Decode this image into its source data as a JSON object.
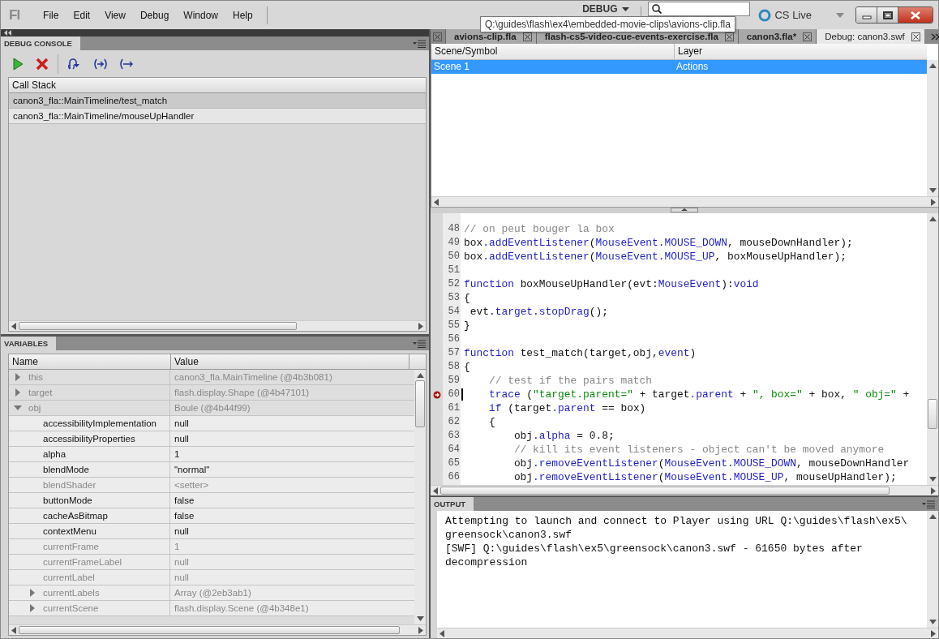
{
  "menu_bar": {
    "logo": "Fl",
    "items": [
      "File",
      "Edit",
      "View",
      "Debug",
      "Window",
      "Help"
    ]
  },
  "workspace": {
    "label": "DEBUG"
  },
  "cs_live": {
    "label": "CS Live"
  },
  "tooltip": {
    "text": "Q:\\guides\\flash\\ex4\\embedded-movie-clips\\avions-clip.fla"
  },
  "debug_console": {
    "title": "DEBUG CONSOLE",
    "call_stack": {
      "heading": "Call Stack",
      "frames": [
        {
          "label": "canon3_fla::MainTimeline/test_match",
          "selected": true
        },
        {
          "label": "canon3_fla::MainTimeline/mouseUpHandler",
          "selected": false
        }
      ]
    }
  },
  "variables": {
    "title": "VARIABLES",
    "columns": [
      "Name",
      "Value"
    ],
    "rows": [
      {
        "kind": "object",
        "name": "this",
        "value": "canon3_fla.MainTimeline (@4b3b081)",
        "expanded": false,
        "dimmed": true
      },
      {
        "kind": "object",
        "name": "target",
        "value": "flash.display.Shape (@4b47101)",
        "expanded": false,
        "dimmed": true
      },
      {
        "kind": "object",
        "name": "obj",
        "value": "Boule (@4b44f99)",
        "expanded": true,
        "dimmed": true,
        "children": [
          {
            "kind": "property",
            "name": "accessibilityImplementation",
            "value": "null",
            "dimmed": false
          },
          {
            "kind": "property",
            "name": "accessibilityProperties",
            "value": "null",
            "dimmed": false
          },
          {
            "kind": "property",
            "name": "alpha",
            "value": "1",
            "dimmed": false
          },
          {
            "kind": "property",
            "name": "blendMode",
            "value": "\"normal\"",
            "dimmed": false
          },
          {
            "kind": "property",
            "name": "blendShader",
            "value": "<setter>",
            "dimmed": true
          },
          {
            "kind": "property",
            "name": "buttonMode",
            "value": "false",
            "dimmed": false
          },
          {
            "kind": "property",
            "name": "cacheAsBitmap",
            "value": "false",
            "dimmed": false
          },
          {
            "kind": "property",
            "name": "contextMenu",
            "value": "null",
            "dimmed": false
          },
          {
            "kind": "property",
            "name": "currentFrame",
            "value": "1",
            "dimmed": true
          },
          {
            "kind": "property",
            "name": "currentFrameLabel",
            "value": "null",
            "dimmed": true
          },
          {
            "kind": "property",
            "name": "currentLabel",
            "value": "null",
            "dimmed": true
          },
          {
            "kind": "object",
            "name": "currentLabels",
            "value": "Array (@2eb3ab1)",
            "expanded": false,
            "dimmed": true
          },
          {
            "kind": "object",
            "name": "currentScene",
            "value": "flash.display.Scene (@4b348e1)",
            "expanded": false,
            "dimmed": true
          }
        ]
      }
    ]
  },
  "document_tabs": [
    {
      "label": "avions-clip.fla",
      "selected": false
    },
    {
      "label": "flash-cs5-video-cue-events-exercise.fla",
      "selected": false
    },
    {
      "label": "canon3.fla*",
      "selected": false
    },
    {
      "label": "Debug: canon3.swf",
      "selected": true
    }
  ],
  "scene_table": {
    "columns": [
      "Scene/Symbol",
      "Layer"
    ],
    "rows": [
      {
        "cells": [
          "Scene 1",
          "Actions"
        ],
        "selected": true
      }
    ]
  },
  "code": {
    "lines": [
      {
        "number": "48",
        "current": false,
        "segments": [
          {
            "kind": "comment",
            "text": "// on peut bouger la box"
          }
        ]
      },
      {
        "number": "49",
        "current": false,
        "segments": [
          {
            "kind": "plain",
            "text": "box"
          },
          {
            "kind": "keyword",
            "text": ".addEventListener"
          },
          {
            "kind": "plain",
            "text": "("
          },
          {
            "kind": "keyword",
            "text": "MouseEvent.MOUSE_DOWN"
          },
          {
            "kind": "plain",
            "text": ", mouseDownHandler);"
          }
        ]
      },
      {
        "number": "50",
        "current": false,
        "segments": [
          {
            "kind": "plain",
            "text": "box"
          },
          {
            "kind": "keyword",
            "text": ".addEventListener"
          },
          {
            "kind": "plain",
            "text": "("
          },
          {
            "kind": "keyword",
            "text": "MouseEvent.MOUSE_UP"
          },
          {
            "kind": "plain",
            "text": ", boxMouseUpHandler);"
          }
        ]
      },
      {
        "number": "51",
        "current": false
      },
      {
        "number": "52",
        "current": false,
        "segments": [
          {
            "kind": "keyword",
            "text": "function"
          },
          {
            "kind": "plain",
            "text": " boxMouseUpHandler(evt:"
          },
          {
            "kind": "keyword",
            "text": "MouseEvent"
          },
          {
            "kind": "plain",
            "text": "):"
          },
          {
            "kind": "keyword",
            "text": "void"
          }
        ]
      },
      {
        "number": "53",
        "current": false,
        "segments": [
          {
            "kind": "plain",
            "text": "{"
          }
        ]
      },
      {
        "number": "54",
        "current": false,
        "segments": [
          {
            "kind": "plain",
            "text": " evt"
          },
          {
            "kind": "keyword",
            "text": ".target.stopDrag"
          },
          {
            "kind": "plain",
            "text": "();"
          }
        ]
      },
      {
        "number": "55",
        "current": false,
        "segments": [
          {
            "kind": "plain",
            "text": "}"
          }
        ]
      },
      {
        "number": "56",
        "current": false
      },
      {
        "number": "57",
        "current": false,
        "segments": [
          {
            "kind": "keyword",
            "text": "function"
          },
          {
            "kind": "plain",
            "text": " test_match(target,obj,"
          },
          {
            "kind": "keyword",
            "text": "event"
          },
          {
            "kind": "plain",
            "text": ")"
          }
        ]
      },
      {
        "number": "58",
        "current": false,
        "segments": [
          {
            "kind": "plain",
            "text": "{"
          }
        ]
      },
      {
        "number": "59",
        "current": false,
        "segments": [
          {
            "kind": "comment",
            "text": "    // test if the pairs match"
          }
        ]
      },
      {
        "number": "60",
        "current": true,
        "segments": [
          {
            "kind": "keyword",
            "text": "    trace"
          },
          {
            "kind": "plain",
            "text": " ("
          },
          {
            "kind": "string",
            "text": "\"target.parent=\""
          },
          {
            "kind": "plain",
            "text": " + target"
          },
          {
            "kind": "keyword",
            "text": ".parent"
          },
          {
            "kind": "plain",
            "text": " + "
          },
          {
            "kind": "string",
            "text": "\", box=\""
          },
          {
            "kind": "plain",
            "text": " + box, "
          },
          {
            "kind": "string",
            "text": "\" obj=\""
          },
          {
            "kind": "plain",
            "text": " +"
          }
        ]
      },
      {
        "number": "61",
        "current": false,
        "segments": [
          {
            "kind": "keyword",
            "text": "    if"
          },
          {
            "kind": "plain",
            "text": " (target"
          },
          {
            "kind": "keyword",
            "text": ".parent"
          },
          {
            "kind": "plain",
            "text": " == box)"
          }
        ]
      },
      {
        "number": "62",
        "current": false,
        "segments": [
          {
            "kind": "plain",
            "text": "    {"
          }
        ]
      },
      {
        "number": "63",
        "current": false,
        "segments": [
          {
            "kind": "plain",
            "text": "        obj"
          },
          {
            "kind": "keyword",
            "text": ".alpha"
          },
          {
            "kind": "plain",
            "text": " = 0.8;"
          }
        ]
      },
      {
        "number": "64",
        "current": false,
        "segments": [
          {
            "kind": "comment",
            "text": "        // kill its event listeners - object can't be moved anymore"
          }
        ]
      },
      {
        "number": "65",
        "current": false,
        "segments": [
          {
            "kind": "plain",
            "text": "        obj"
          },
          {
            "kind": "keyword",
            "text": ".removeEventListener"
          },
          {
            "kind": "plain",
            "text": "("
          },
          {
            "kind": "keyword",
            "text": "MouseEvent.MOUSE_DOWN"
          },
          {
            "kind": "plain",
            "text": ", mouseDownHandler"
          }
        ]
      },
      {
        "number": "66",
        "current": false,
        "segments": [
          {
            "kind": "plain",
            "text": "        obj"
          },
          {
            "kind": "keyword",
            "text": ".removeEventListener"
          },
          {
            "kind": "plain",
            "text": "("
          },
          {
            "kind": "keyword",
            "text": "MouseEvent.MOUSE_UP"
          },
          {
            "kind": "plain",
            "text": ", mouseUpHandler);"
          }
        ]
      }
    ]
  },
  "output": {
    "title": "OUTPUT",
    "lines": [
      "Attempting to launch and connect to Player using URL Q:\\guides\\flash\\ex5\\",
      "greensock\\canon3.swf",
      "[SWF] Q:\\guides\\flash\\ex5\\greensock\\canon3.swf - 61650 bytes after",
      "decompression"
    ]
  }
}
